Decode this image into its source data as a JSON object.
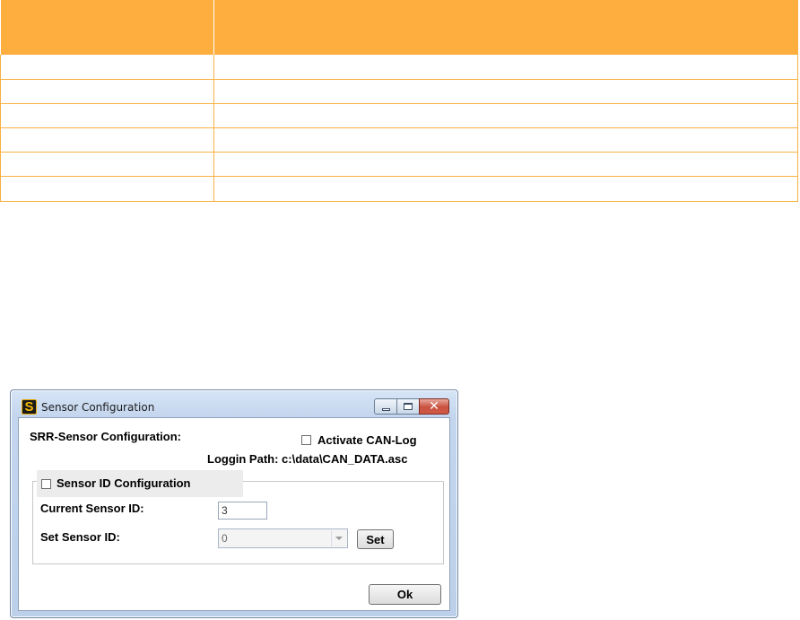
{
  "table": {
    "rows": [
      [
        "",
        ""
      ],
      [
        "",
        ""
      ],
      [
        "",
        ""
      ],
      [
        "",
        ""
      ],
      [
        "",
        ""
      ],
      [
        "",
        ""
      ]
    ]
  },
  "window": {
    "title": "Sensor Configuration",
    "app_icon_letter": "S",
    "caption": {
      "minimize_icon": "minimize-icon",
      "maximize_icon": "maximize-icon",
      "close_glyph": "✕"
    }
  },
  "dialog": {
    "heading": "SRR-Sensor Configuration:",
    "can_log_label": "Activate CAN-Log",
    "can_log_checked": false,
    "logging_path": "Loggin Path: c:\\data\\CAN_DATA.asc",
    "group": {
      "label": "Sensor ID Configuration",
      "checked": false,
      "current_id_label": "Current Sensor ID:",
      "current_id_value": "3",
      "set_id_label": "Set Sensor ID:",
      "set_id_selected": "0",
      "set_button_label": "Set"
    },
    "ok_button_label": "Ok"
  },
  "colors": {
    "table_header": "#fdae3f",
    "table_border": "#f8b142",
    "window_frame": "#c4d6ee",
    "close_button": "#c8513f"
  }
}
